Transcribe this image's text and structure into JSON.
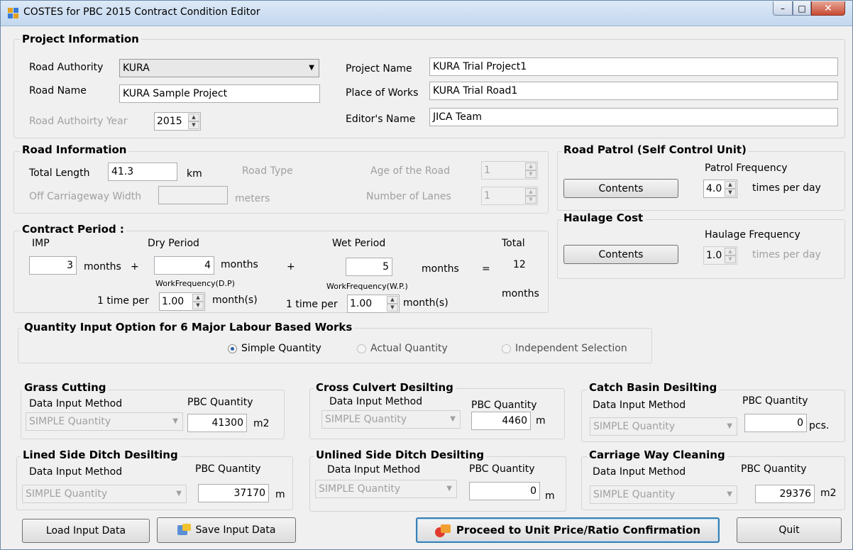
{
  "window": {
    "title": "COSTES for PBC 2015 Contract Condition Editor",
    "controls": {
      "minimize": "–",
      "maximize": "□",
      "close": "✕"
    }
  },
  "project": {
    "legend": "Project Information",
    "road_authority_label": "Road Authority",
    "road_authority_value": "KURA",
    "road_name_label": "Road Name",
    "road_name_value": "KURA Sample Project",
    "year_label": "Road Authoirty Year",
    "year_value": "2015",
    "project_name_label": "Project Name",
    "project_name_value": "KURA Trial Project1",
    "place_label": "Place of Works",
    "place_value": "KURA Trial Road1",
    "editor_label": "Editor's Name",
    "editor_value": "JICA Team"
  },
  "road_info": {
    "legend": "Road Information",
    "total_length_label": "Total Length",
    "total_length_value": "41.3",
    "km_unit": "km",
    "road_type_label": "Road Type",
    "age_label": "Age of the Road",
    "age_value": "1",
    "off_cw_label": "Off Carriageway Width",
    "off_cw_value": "",
    "meters_unit": "meters",
    "lanes_label": "Number of Lanes",
    "lanes_value": "1"
  },
  "road_patrol": {
    "legend": "Road Patrol (Self Control Unit)",
    "contents_button": "Contents",
    "freq_label": "Patrol Frequency",
    "freq_value": "4.0",
    "freq_unit": "times per day"
  },
  "haulage": {
    "legend": "Haulage Cost",
    "contents_button": "Contents",
    "freq_label": "Haulage Frequency",
    "freq_value": "1.0",
    "freq_unit": "times per day"
  },
  "contract": {
    "legend": "Contract Period :",
    "imp_label": "IMP",
    "imp_value": "3",
    "months": "months",
    "plus": "+",
    "equals": "=",
    "dry_label": "Dry Period",
    "dry_value": "4",
    "wet_label": "Wet Period",
    "wet_value": "5",
    "total_label": "Total",
    "total_value": "12",
    "wf_dp_label": "WorkFrequency(D.P)",
    "wf_wp_label": "WorkFrequency(W.P.)",
    "time_per": "1 time per",
    "dp_value": "1.00",
    "wp_value": "1.00",
    "month_s": "month(s)"
  },
  "quantity_option": {
    "legend": "Quantity Input Option for 6 Major Labour Based Works",
    "simple": "Simple Quantity",
    "actual": "Actual Quantity",
    "independent": "Independent Selection"
  },
  "works": {
    "dim_label": "Data Input Method",
    "pbc_label": "PBC Quantity",
    "method_value": "SIMPLE Quantity",
    "grass": {
      "legend": "Grass Cutting",
      "qty": "41300",
      "unit": "m2"
    },
    "cross": {
      "legend": "Cross Culvert Desilting",
      "qty": "4460",
      "unit": "m"
    },
    "catch": {
      "legend": "Catch Basin Desilting",
      "qty": "0",
      "unit": "pcs."
    },
    "lined": {
      "legend": "Lined Side Ditch Desilting",
      "qty": "37170",
      "unit": "m"
    },
    "unlined": {
      "legend": "Unlined Side Ditch Desilting",
      "qty": "0",
      "unit": "m"
    },
    "carriage": {
      "legend": "Carriage Way Cleaning",
      "qty": "29376",
      "unit": "m2"
    }
  },
  "buttons": {
    "load": "Load Input Data",
    "save": "Save Input Data",
    "proceed": "Proceed to Unit Price/Ratio Confirmation",
    "quit": "Quit"
  }
}
